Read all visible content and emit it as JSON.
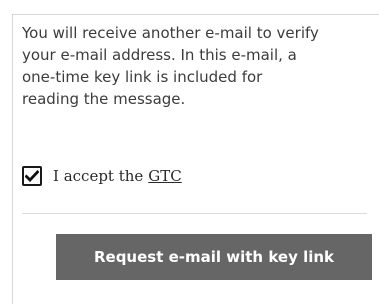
{
  "message": {
    "lines": [
      "You will receive another e-mail to verify",
      "your e-mail address. In this e-mail, a",
      "one-time key link is included for",
      "reading the message."
    ]
  },
  "terms": {
    "checked": true,
    "checkbox_icon": "checkmark-icon",
    "label": "I accept the",
    "link_text": "GTC"
  },
  "actions": {
    "request_label": "Request e-mail with key link"
  },
  "colors": {
    "button_bg": "#666666",
    "button_text": "#ffffff",
    "text": "#3c3c3c",
    "divider": "#dcdcdc"
  }
}
